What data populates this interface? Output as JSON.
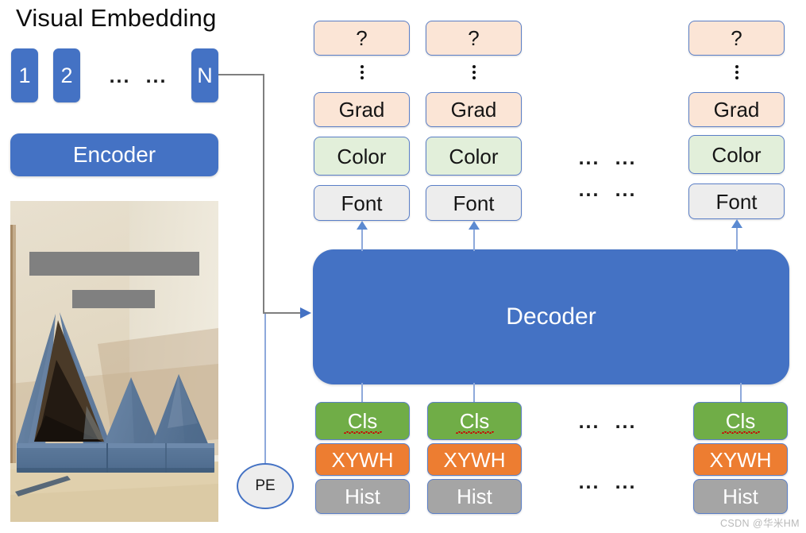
{
  "diagram": {
    "title": "Visual Embedding",
    "embedding_tokens": [
      "1",
      "2",
      "N"
    ],
    "embedding_ellipses": [
      "...",
      "..."
    ],
    "encoder_label": "Encoder",
    "decoder_label": "Decoder",
    "pe_label": "PE",
    "vertical_dots": "⋮",
    "column_gap_dots": [
      "...",
      "..."
    ],
    "output_columns": [
      {
        "question": "?",
        "dots": "⋮",
        "grad": "Grad",
        "color": "Color",
        "font": "Font"
      },
      {
        "question": "?",
        "dots": "⋮",
        "grad": "Grad",
        "color": "Color",
        "font": "Font"
      },
      {
        "question": "?",
        "dots": "⋮",
        "grad": "Grad",
        "color": "Color",
        "font": "Font"
      }
    ],
    "input_columns": [
      {
        "cls": "Cls",
        "xywh": "XYWH",
        "hist": "Hist"
      },
      {
        "cls": "Cls",
        "xywh": "XYWH",
        "hist": "Hist"
      },
      {
        "cls": "Cls",
        "xywh": "XYWH",
        "hist": "Hist"
      }
    ],
    "middle_dots_upper": [
      "...",
      "..."
    ],
    "middle_dots_lower": [
      "...",
      "..."
    ],
    "middle_dots_bottom_upper": [
      "...",
      "..."
    ],
    "middle_dots_bottom_lower": [
      "...",
      "..."
    ],
    "photo": {
      "alt": "blue triangular foam play-couch cushions on beige background",
      "redaction_bars": 2
    },
    "colors": {
      "primary_blue": "#4472C4",
      "peach": "#FBE5D6",
      "light_green": "#E2EFDA",
      "light_gray": "#EDEDED",
      "green": "#70AD47",
      "orange": "#ED7D31",
      "gray": "#A5A5A5",
      "border_blue": "#5B7FC7",
      "connector_blue": "#8EA9DB"
    }
  },
  "watermark": "CSDN @华米HM"
}
